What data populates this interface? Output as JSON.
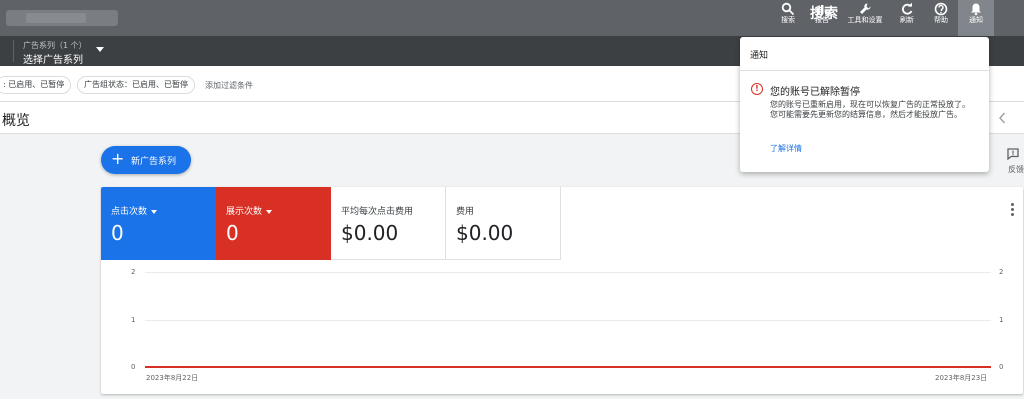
{
  "toolbar": {
    "search_overlay": "搜索",
    "items": [
      {
        "label": "搜索",
        "icon": "search-icon"
      },
      {
        "label": "报告",
        "icon": "report-icon"
      },
      {
        "label": "工具和设置",
        "icon": "wrench-icon"
      },
      {
        "label": "刷新",
        "icon": "refresh-icon"
      },
      {
        "label": "帮助",
        "icon": "help-icon"
      },
      {
        "label": "通知",
        "icon": "bell-icon"
      }
    ]
  },
  "campaign_selector": {
    "subtitle": "广告系列（1 个）",
    "title": "选择广告系列"
  },
  "filters": {
    "chips": [
      ": 已启用、已暂停",
      "广告组状态：已启用、已暂停"
    ],
    "add_filter": "添加过滤条件"
  },
  "page": {
    "title": "概览",
    "new_campaign": "新广告系列",
    "feedback": "反馈"
  },
  "metrics": [
    {
      "name": "点击次数",
      "value": "0",
      "color": "#1a73e8"
    },
    {
      "name": "展示次数",
      "value": "0",
      "color": "#d93025"
    },
    {
      "name": "平均每次点击费用",
      "value": "$0.00"
    },
    {
      "name": "费用",
      "value": "$0.00"
    }
  ],
  "chart_data": {
    "type": "line",
    "x": [
      "2023年8月22日",
      "2023年8月23日"
    ],
    "series": [
      {
        "values": [
          0,
          0
        ],
        "color": "#d93025"
      }
    ],
    "y_ticks_left": [
      "2",
      "1",
      "0"
    ],
    "y_ticks_right": [
      "2",
      "1",
      "0"
    ],
    "ylim": [
      0,
      2
    ],
    "grid": true
  },
  "notification": {
    "header": "通知",
    "title": "您的账号已解除暂停",
    "body": "您的账号已重新启用，现在可以恢复广告的正常投放了。您可能需要先更新您的结算信息，然后才能投放广告。",
    "link": "了解详情"
  }
}
